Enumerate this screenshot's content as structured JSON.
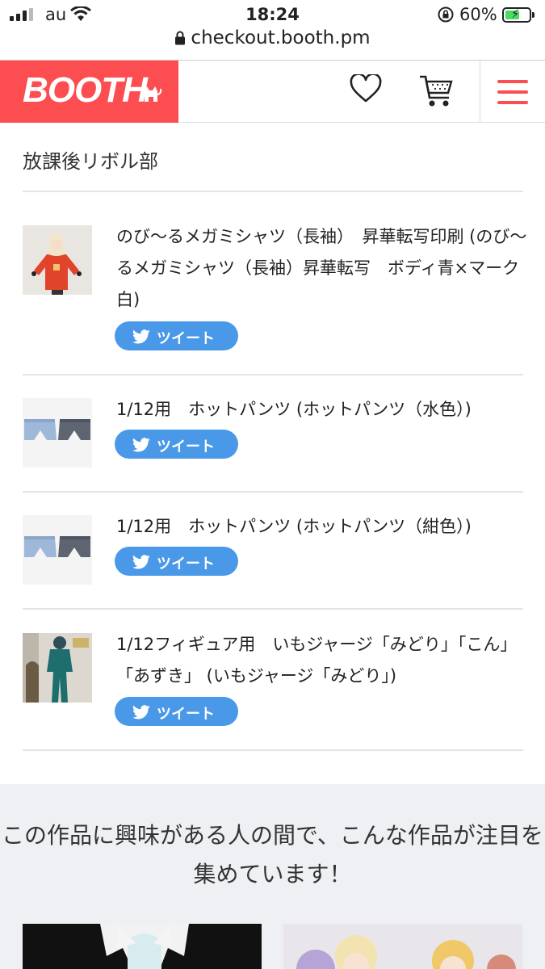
{
  "status_bar": {
    "carrier": "au",
    "time": "18:24",
    "battery": "60%",
    "battery_level": 0.6
  },
  "browser": {
    "url": "checkout.booth.pm"
  },
  "header": {
    "logo": "BOOTH"
  },
  "shop": {
    "name": "放課後リボル部"
  },
  "tweet_label": "ツイート",
  "items": [
    {
      "title": "のび〜るメガミシャツ（長袖）　昇華転写印刷 (のび〜るメガミシャツ（長袖）昇華転写　ボディ青×マーク白)"
    },
    {
      "title": "1/12用　ホットパンツ (ホットパンツ（水色）)"
    },
    {
      "title": "1/12用　ホットパンツ (ホットパンツ（紺色）)"
    },
    {
      "title": "1/12フィギュア用　いもジャージ「みどり」「こん」「あずき」 (いもジャージ「みどり」)"
    }
  ],
  "recommend": {
    "heading": "この作品に興味がある人の間で、こんな作品が注目を集めています！"
  },
  "colors": {
    "brand": "#fc4d50",
    "twitter": "#4a99e9",
    "reco_bg": "#eef0f3"
  }
}
